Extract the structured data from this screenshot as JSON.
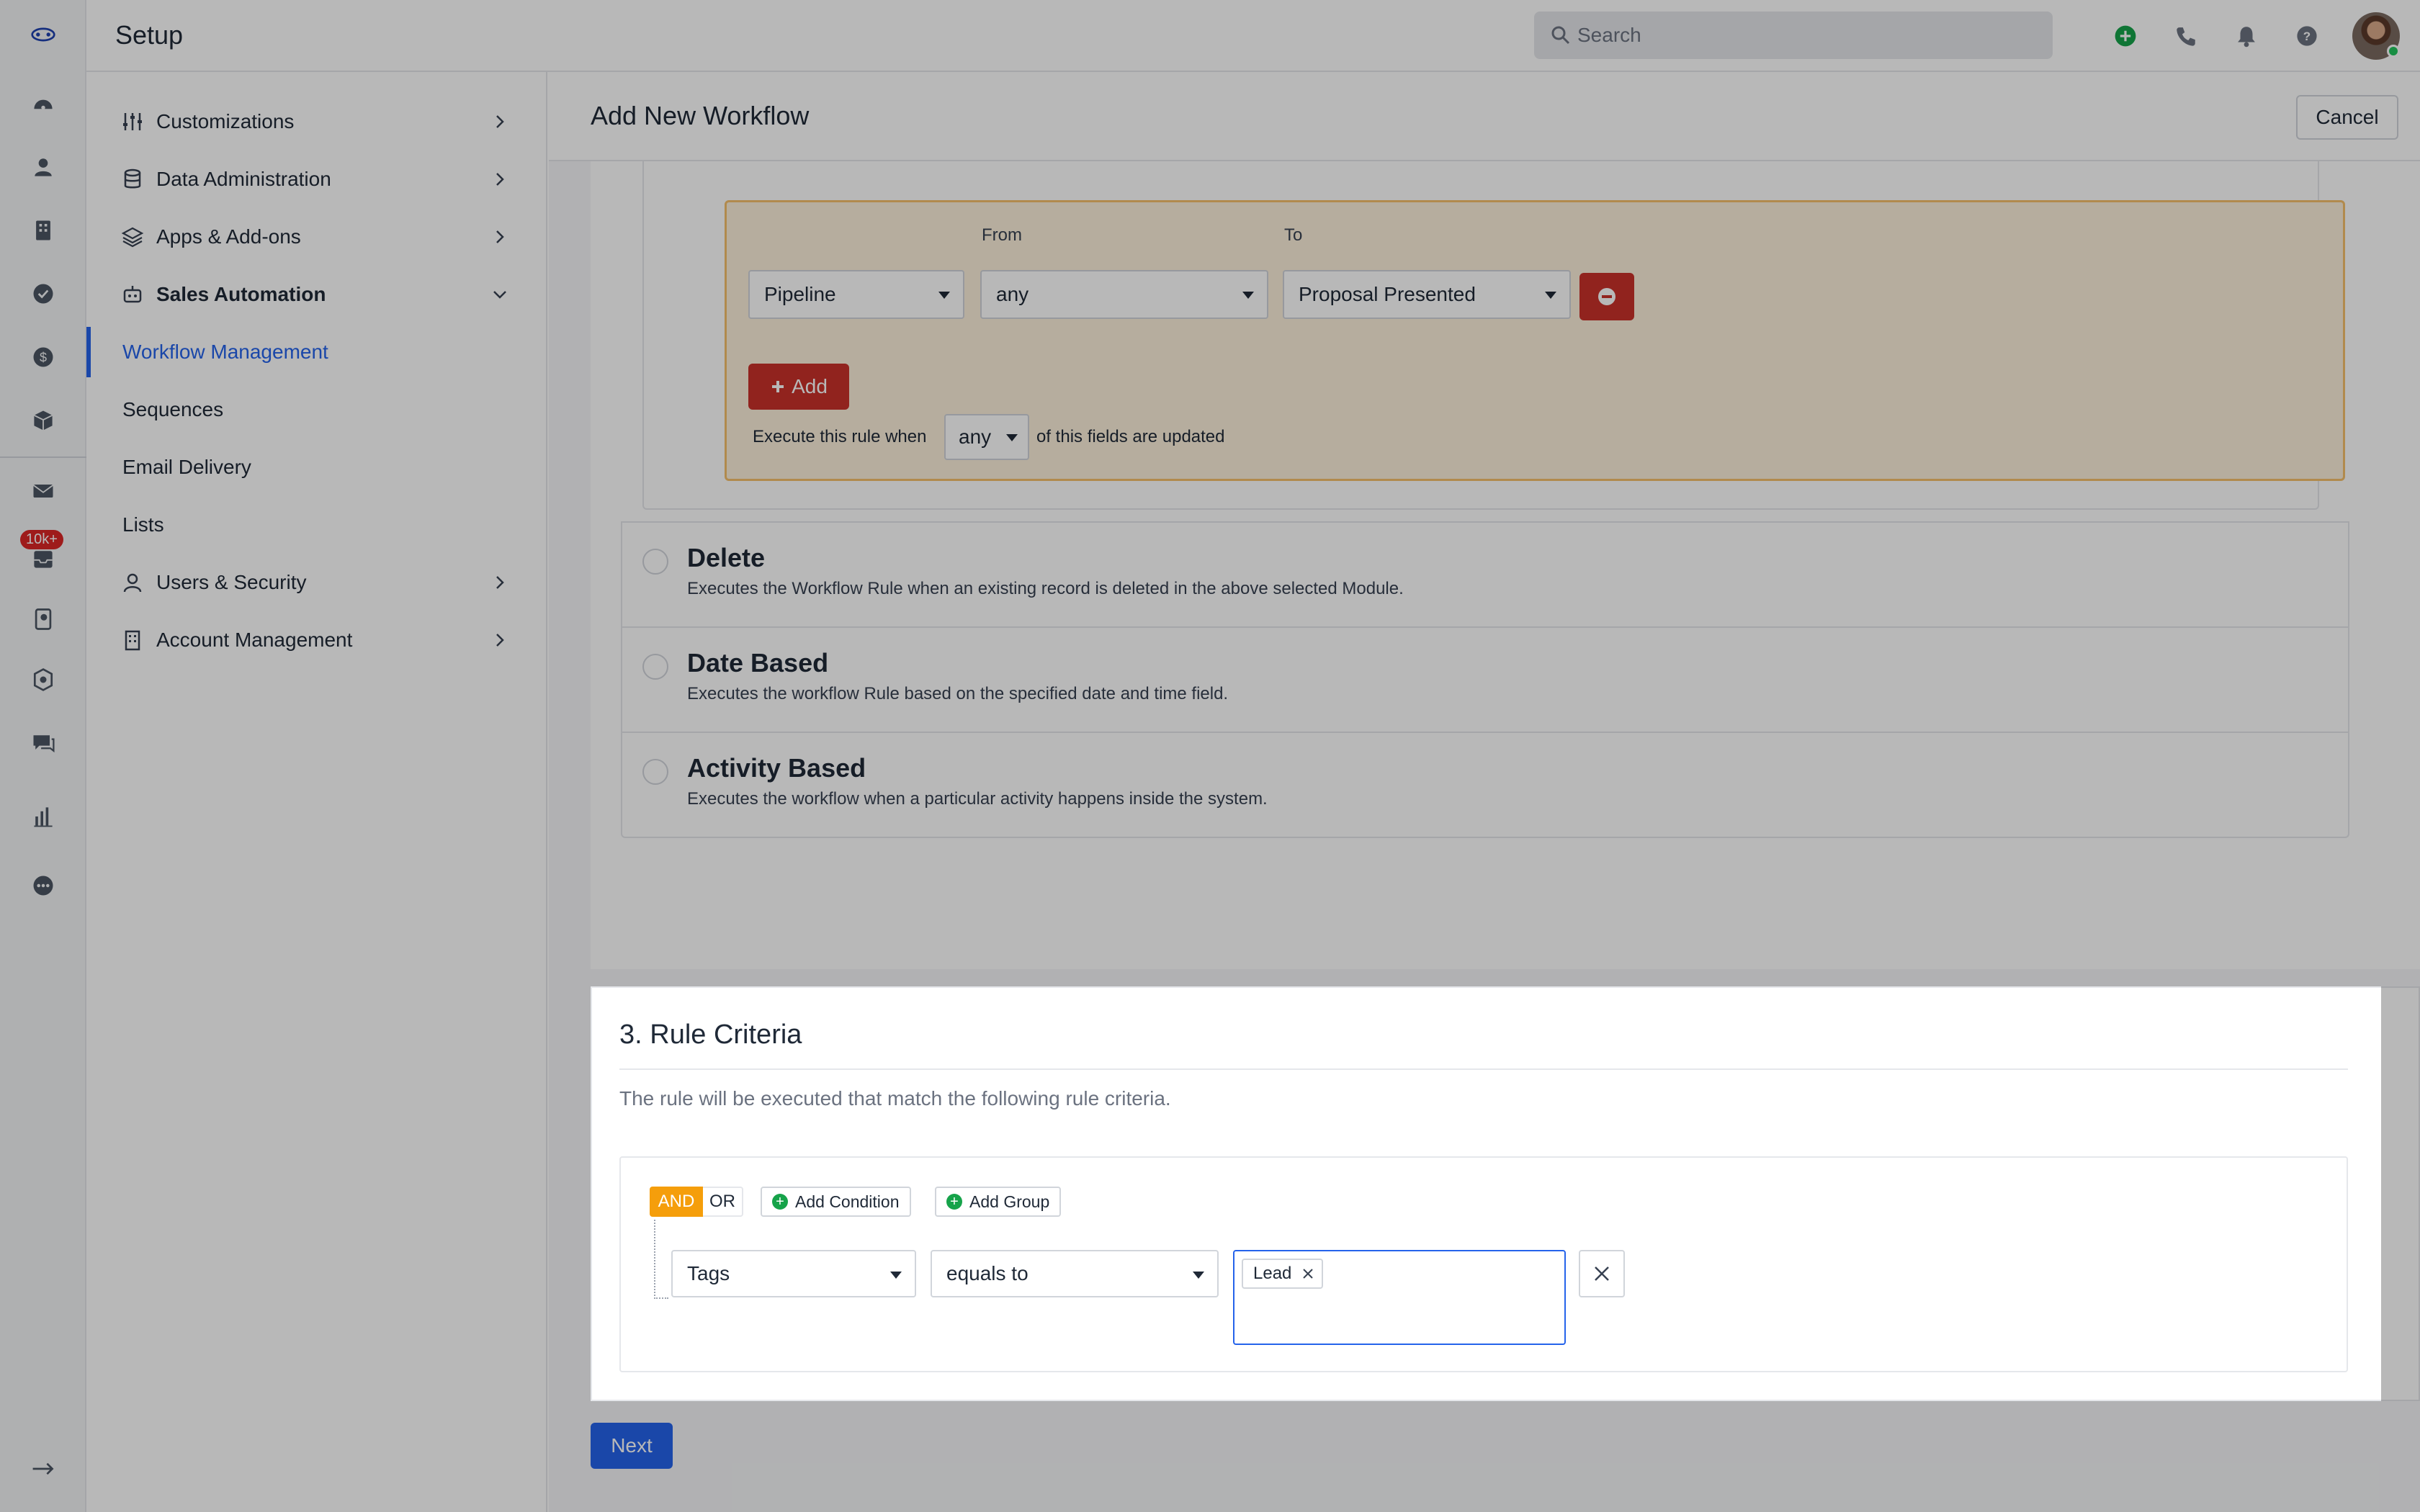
{
  "header": {
    "title": "Setup",
    "search_placeholder": "Search",
    "icons": [
      "plus-circle-icon",
      "phone-icon",
      "bell-icon",
      "help-icon",
      "avatar"
    ]
  },
  "rail": {
    "badge": "10k+",
    "icons": [
      "logo-icon",
      "dashboard-icon",
      "person-icon",
      "building-icon",
      "check-circle-icon",
      "dollar-icon",
      "box-icon",
      "mail-icon",
      "inbox-icon",
      "phone-book-icon",
      "settings-badge-icon",
      "chat-icon",
      "bar-chart-icon",
      "more-icon",
      "expand-arrow-icon"
    ]
  },
  "sidebar": {
    "items": [
      {
        "label": "Customizations",
        "icon": "sliders-icon",
        "chevron": "right"
      },
      {
        "label": "Data Administration",
        "icon": "database-icon",
        "chevron": "right"
      },
      {
        "label": "Apps & Add-ons",
        "icon": "layers-icon",
        "chevron": "right"
      },
      {
        "label": "Sales Automation",
        "icon": "robot-icon",
        "chevron": "down"
      },
      {
        "label": "Workflow Management",
        "active": true
      },
      {
        "label": "Sequences"
      },
      {
        "label": "Email Delivery"
      },
      {
        "label": "Lists"
      },
      {
        "label": "Users & Security",
        "icon": "user-icon",
        "chevron": "right"
      },
      {
        "label": "Account Management",
        "icon": "building-icon",
        "chevron": "right"
      }
    ]
  },
  "page": {
    "title": "Add New Workflow",
    "cancel_label": "Cancel",
    "next_label": "Next"
  },
  "pipeline_rule": {
    "from_label": "From",
    "to_label": "To",
    "field_value": "Pipeline",
    "from_value": "any",
    "to_value": "Proposal Presented",
    "add_label": "Add",
    "exec_prefix": "Execute this rule when",
    "exec_value": "any",
    "exec_suffix": "of this fields are updated"
  },
  "trigger_options": [
    {
      "title": "Delete",
      "desc": "Executes the Workflow Rule when an existing record is deleted in the above selected Module."
    },
    {
      "title": "Date Based",
      "desc": "Executes the workflow Rule based on the specified date and time field."
    },
    {
      "title": "Activity Based",
      "desc": "Executes the workflow when a particular activity happens inside the system."
    }
  ],
  "rule_criteria": {
    "title": "3. Rule Criteria",
    "description": "The rule will be executed that match the following rule criteria.",
    "and_label": "AND",
    "or_label": "OR",
    "add_condition_label": "Add Condition",
    "add_group_label": "Add Group",
    "condition": {
      "field": "Tags",
      "operator": "equals to",
      "tags": [
        "Lead"
      ]
    }
  },
  "colors": {
    "primary": "#2563eb",
    "danger": "#c9312a",
    "and_active": "#f59e0b",
    "pipeline_bg": "#fcf0dc"
  }
}
